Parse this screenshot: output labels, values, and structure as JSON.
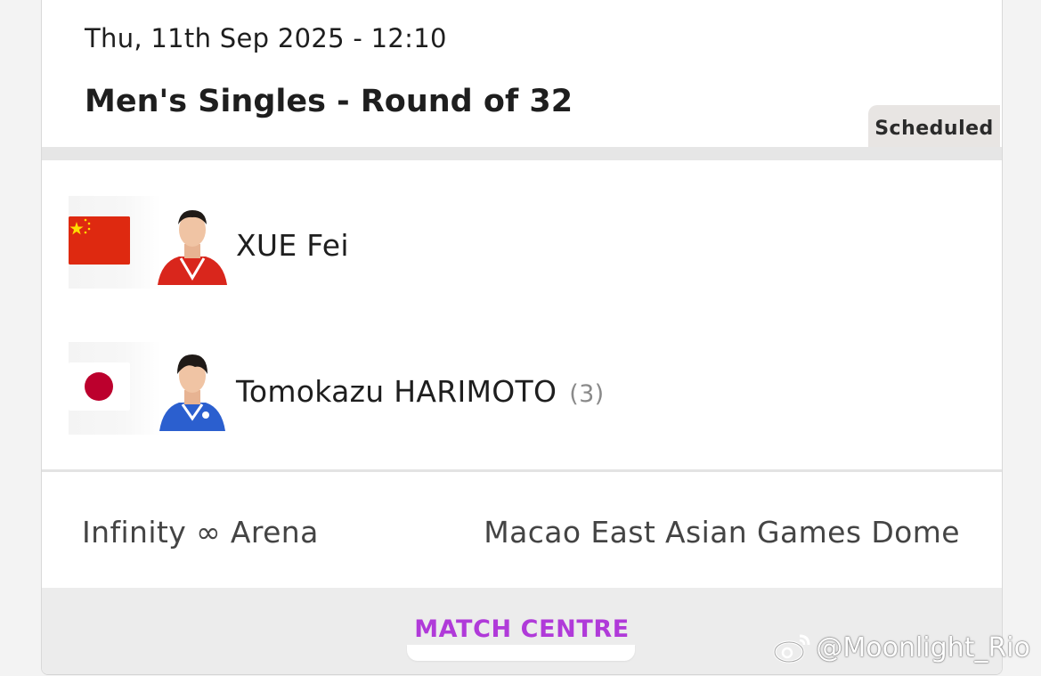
{
  "match": {
    "datetime": "Thu, 11th Sep 2025 - 12:10",
    "event": "Men's Singles - Round of 32",
    "status": "Scheduled"
  },
  "players": [
    {
      "name": "XUE Fei",
      "seed": "",
      "flag": "china-flag"
    },
    {
      "name": "Tomokazu HARIMOTO",
      "seed": "(3)",
      "flag": "japan-flag"
    }
  ],
  "venue": {
    "hall": "Infinity ∞ Arena",
    "building": "Macao East Asian Games Dome"
  },
  "footer": {
    "match_centre_label": "MATCH CENTRE"
  },
  "watermark": {
    "text": "@Moonlight_Rio",
    "icon": "weibo-icon"
  },
  "colors": {
    "accent": "#b03ad9",
    "china_red": "#de2910",
    "china_star": "#ffde00",
    "japan_red": "#bc002d"
  }
}
